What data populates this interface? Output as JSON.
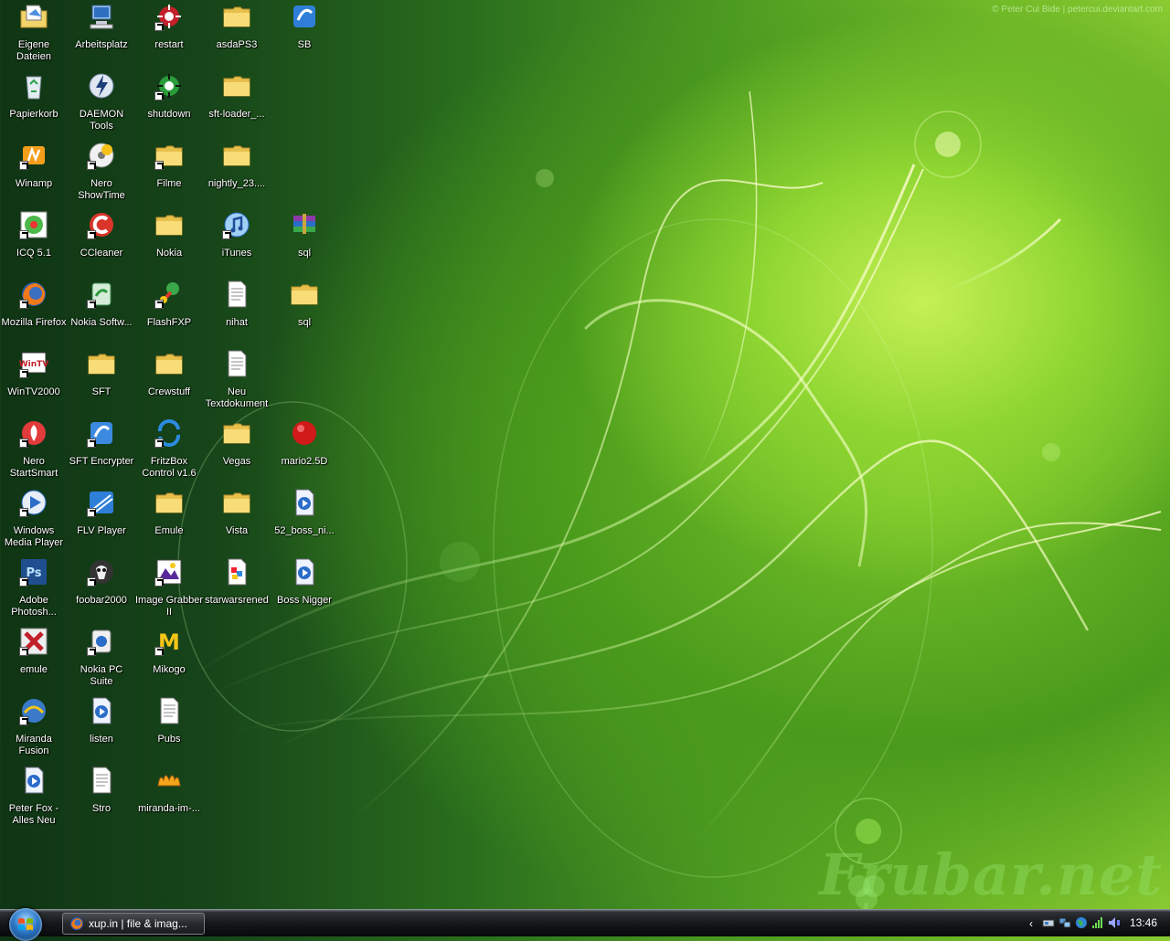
{
  "wallpaper": {
    "credit": "© Peter Cui Bide | petercui.deviantart.com",
    "brand": "Frubar.net"
  },
  "icons": [
    {
      "label": "Eigene Dateien",
      "icon": "my-documents-icon",
      "col": 0,
      "row": 0,
      "shortcut": false
    },
    {
      "label": "Arbeitsplatz",
      "icon": "my-computer-icon",
      "col": 1,
      "row": 0,
      "shortcut": false
    },
    {
      "label": "restart",
      "icon": "restart-icon",
      "col": 2,
      "row": 0,
      "shortcut": true
    },
    {
      "label": "asdaPS3",
      "icon": "folder-icon",
      "col": 3,
      "row": 0,
      "shortcut": false
    },
    {
      "label": "SB",
      "icon": "sb-app-icon",
      "col": 4,
      "row": 0,
      "shortcut": false
    },
    {
      "label": "Papierkorb",
      "icon": "recycle-bin-icon",
      "col": 0,
      "row": 1,
      "shortcut": false
    },
    {
      "label": "DAEMON Tools",
      "icon": "daemon-tools-icon",
      "col": 1,
      "row": 1,
      "shortcut": false
    },
    {
      "label": "shutdown",
      "icon": "shutdown-icon",
      "col": 2,
      "row": 1,
      "shortcut": true
    },
    {
      "label": "sft-loader_...",
      "icon": "folder-icon",
      "col": 3,
      "row": 1,
      "shortcut": false
    },
    {
      "label": "Winamp",
      "icon": "winamp-icon",
      "col": 0,
      "row": 2,
      "shortcut": true
    },
    {
      "label": "Nero ShowTime",
      "icon": "nero-showtime-icon",
      "col": 1,
      "row": 2,
      "shortcut": true
    },
    {
      "label": "Filme",
      "icon": "folder-icon",
      "col": 2,
      "row": 2,
      "shortcut": true
    },
    {
      "label": "nightly_23....",
      "icon": "folder-icon",
      "col": 3,
      "row": 2,
      "shortcut": false
    },
    {
      "label": "ICQ 5.1",
      "icon": "icq-icon",
      "col": 0,
      "row": 3,
      "shortcut": true
    },
    {
      "label": "CCleaner",
      "icon": "ccleaner-icon",
      "col": 1,
      "row": 3,
      "shortcut": true
    },
    {
      "label": "Nokia",
      "icon": "folder-icon",
      "col": 2,
      "row": 3,
      "shortcut": false
    },
    {
      "label": "iTunes",
      "icon": "itunes-icon",
      "col": 3,
      "row": 3,
      "shortcut": true
    },
    {
      "label": "sql",
      "icon": "winrar-archive-icon",
      "col": 4,
      "row": 3,
      "shortcut": false
    },
    {
      "label": "Mozilla Firefox",
      "icon": "firefox-icon",
      "col": 0,
      "row": 4,
      "shortcut": true
    },
    {
      "label": "Nokia Softw...",
      "icon": "nokia-software-icon",
      "col": 1,
      "row": 4,
      "shortcut": true
    },
    {
      "label": "FlashFXP",
      "icon": "flashfxp-icon",
      "col": 2,
      "row": 4,
      "shortcut": true
    },
    {
      "label": "nihat",
      "icon": "text-document-icon",
      "col": 3,
      "row": 4,
      "shortcut": false
    },
    {
      "label": "sql",
      "icon": "folder-icon",
      "col": 4,
      "row": 4,
      "shortcut": false
    },
    {
      "label": "WinTV2000",
      "icon": "wintv-icon",
      "col": 0,
      "row": 5,
      "shortcut": true
    },
    {
      "label": "SFT",
      "icon": "folder-icon",
      "col": 1,
      "row": 5,
      "shortcut": false
    },
    {
      "label": "Crewstuff",
      "icon": "folder-icon",
      "col": 2,
      "row": 5,
      "shortcut": false
    },
    {
      "label": "Neu Textdokument",
      "icon": "text-document-icon",
      "col": 3,
      "row": 5,
      "shortcut": false
    },
    {
      "label": "Nero StartSmart",
      "icon": "nero-startsmart-icon",
      "col": 0,
      "row": 6,
      "shortcut": true
    },
    {
      "label": "SFT Encrypter",
      "icon": "sft-encrypter-icon",
      "col": 1,
      "row": 6,
      "shortcut": true
    },
    {
      "label": "FritzBox Control v1.6",
      "icon": "fritzbox-icon",
      "col": 2,
      "row": 6,
      "shortcut": true
    },
    {
      "label": "Vegas",
      "icon": "folder-icon",
      "col": 3,
      "row": 6,
      "shortcut": false
    },
    {
      "label": "mario2.5D",
      "icon": "red-ball-icon",
      "col": 4,
      "row": 6,
      "shortcut": false
    },
    {
      "label": "Windows Media Player",
      "icon": "windows-media-player-icon",
      "col": 0,
      "row": 7,
      "shortcut": true
    },
    {
      "label": "FLV Player",
      "icon": "flv-player-icon",
      "col": 1,
      "row": 7,
      "shortcut": true
    },
    {
      "label": "Emule",
      "icon": "folder-icon",
      "col": 2,
      "row": 7,
      "shortcut": false
    },
    {
      "label": "Vista",
      "icon": "folder-icon",
      "col": 3,
      "row": 7,
      "shortcut": false
    },
    {
      "label": "52_boss_ni...",
      "icon": "media-file-icon",
      "col": 4,
      "row": 7,
      "shortcut": false
    },
    {
      "label": "Adobe Photosh...",
      "icon": "photoshop-icon",
      "col": 0,
      "row": 8,
      "shortcut": true
    },
    {
      "label": "foobar2000",
      "icon": "foobar2000-icon",
      "col": 1,
      "row": 8,
      "shortcut": true
    },
    {
      "label": "Image Grabber II",
      "icon": "image-grabber-icon",
      "col": 2,
      "row": 8,
      "shortcut": true
    },
    {
      "label": "starwarsrened",
      "icon": "image-file-icon",
      "col": 3,
      "row": 8,
      "shortcut": false
    },
    {
      "label": "Boss Nigger",
      "icon": "media-file-icon",
      "col": 4,
      "row": 8,
      "shortcut": false
    },
    {
      "label": "emule",
      "icon": "emule-icon",
      "col": 0,
      "row": 9,
      "shortcut": true
    },
    {
      "label": "Nokia PC Suite",
      "icon": "nokia-pc-suite-icon",
      "col": 1,
      "row": 9,
      "shortcut": true
    },
    {
      "label": "Mikogo",
      "icon": "mikogo-icon",
      "col": 2,
      "row": 9,
      "shortcut": true
    },
    {
      "label": "Miranda Fusion",
      "icon": "miranda-fusion-icon",
      "col": 0,
      "row": 10,
      "shortcut": true
    },
    {
      "label": "listen",
      "icon": "media-file-icon",
      "col": 1,
      "row": 10,
      "shortcut": false
    },
    {
      "label": "Pubs",
      "icon": "text-document-icon",
      "col": 2,
      "row": 10,
      "shortcut": false
    },
    {
      "label": "Peter Fox - Alles Neu",
      "icon": "media-file-icon",
      "col": 0,
      "row": 11,
      "shortcut": false
    },
    {
      "label": "Stro",
      "icon": "text-document-icon",
      "col": 1,
      "row": 11,
      "shortcut": false
    },
    {
      "label": "miranda-im-...",
      "icon": "miranda-im-icon",
      "col": 2,
      "row": 11,
      "shortcut": false
    }
  ],
  "taskbar": {
    "start_icon": "windows-start-orb-icon",
    "task_button_label": "xup.in | file & imag...",
    "task_button_icon": "firefox-icon",
    "tray_chevron": "‹",
    "tray_icons": [
      "safely-remove-hardware-icon",
      "network-icon",
      "globe-icon",
      "wireless-signal-icon",
      "volume-icon"
    ],
    "clock": "13:46"
  }
}
